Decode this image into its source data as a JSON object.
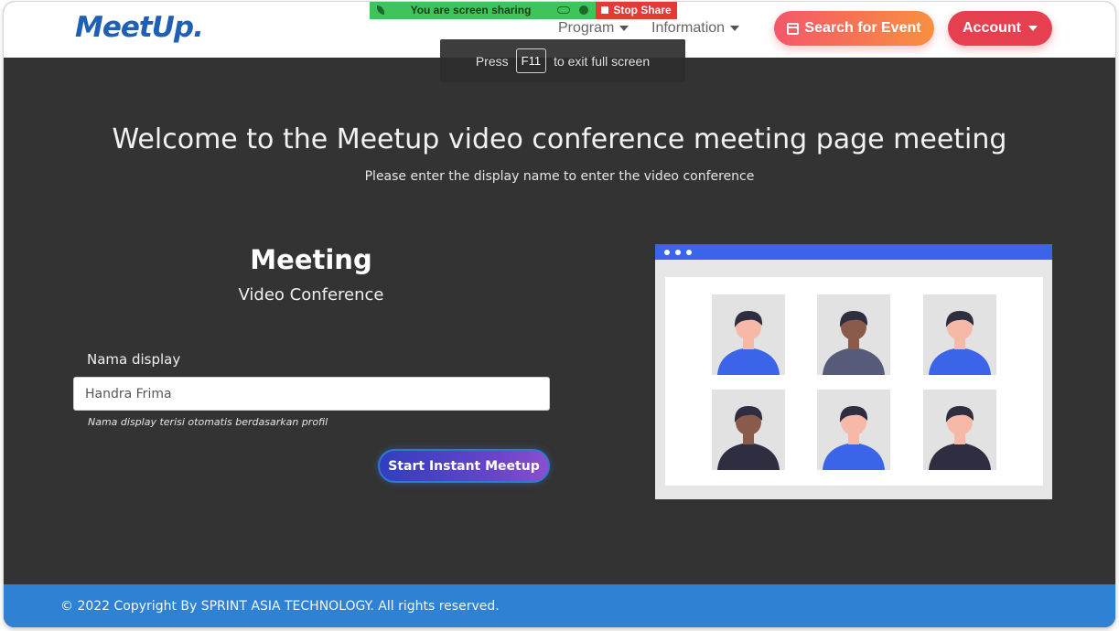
{
  "header": {
    "logo": "MeetUp.",
    "nav": [
      {
        "label": "Program"
      },
      {
        "label": "Information"
      }
    ],
    "search_button": "Search for Event",
    "account_button": "Account"
  },
  "share_bar": {
    "message": "You are screen sharing",
    "stop_label": "Stop Share"
  },
  "fullscreen_hint": {
    "press": "Press",
    "key": "F11",
    "suffix": "to exit full screen"
  },
  "hero": {
    "title": "Welcome to the Meetup video conference meeting page meeting",
    "subtitle": "Please enter the display name to enter the video conference"
  },
  "form": {
    "title": "Meeting",
    "subtitle": "Video Conference",
    "label": "Nama display",
    "value": "Handra Frima",
    "hint": "Nama display terisi otomatis berdasarkan profil",
    "submit": "Start Instant Meetup"
  },
  "illustration": {
    "participants": [
      {
        "shirt": "#3c64e8",
        "skin": "#f6b9a8",
        "hair": "#2f2e41"
      },
      {
        "shirt": "#555b78",
        "skin": "#8a5a4a",
        "hair": "#2f2e41"
      },
      {
        "shirt": "#3c64e8",
        "skin": "#f6b9a8",
        "hair": "#2f2e41"
      },
      {
        "shirt": "#2f2e41",
        "skin": "#8a5a4a",
        "hair": "#2f2e41"
      },
      {
        "shirt": "#3c64e8",
        "skin": "#f6b9a8",
        "hair": "#2f2e41"
      },
      {
        "shirt": "#2f2e41",
        "skin": "#f6b9a8",
        "hair": "#2f2e41"
      }
    ]
  },
  "footer": {
    "copyright": "© 2022 Copyright By SPRINT ASIA TECHNOLOGY. All rights reserved."
  },
  "colors": {
    "background": "#333333",
    "brand_blue": "#1f5fb5",
    "footer": "#2f82d3",
    "search_gradient_start": "#f4576a",
    "search_gradient_end": "#f8903f",
    "account": "#e64050",
    "share_green": "#3ec45a",
    "stop_red": "#e53935"
  }
}
